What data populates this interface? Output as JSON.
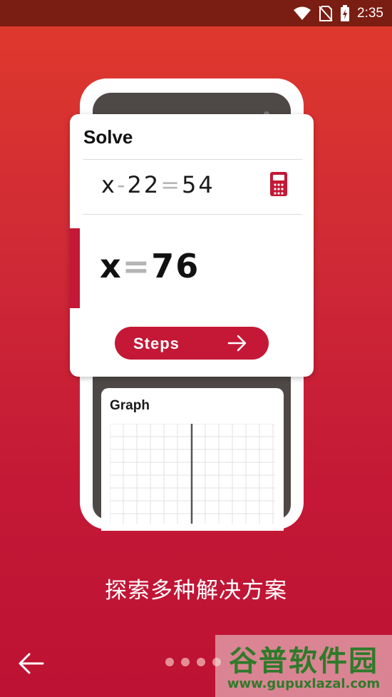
{
  "status_bar": {
    "time": "2:35",
    "icons": [
      "wifi-icon",
      "no-sim-icon",
      "battery-charging-icon"
    ]
  },
  "solve_card": {
    "title": "Solve",
    "equation": {
      "lhs_var": "x",
      "minus": "-",
      "num1": "22",
      "equals": "=",
      "num2": "54"
    },
    "result": {
      "var": "x",
      "equals": "=",
      "value": "76"
    },
    "steps_label": "Steps",
    "icon": "calculator-icon"
  },
  "graph_card": {
    "title": "Graph"
  },
  "caption": "探索多种解决方案",
  "navigation": {
    "back_icon": "arrow-left-icon",
    "page_count": 4
  },
  "watermark": {
    "title": "谷普软件园",
    "url": "www.gupuxlazal.com"
  },
  "colors": {
    "accent": "#c41836",
    "status_bar": "#7a1d12",
    "operator_gray": "#b5b5b5"
  }
}
